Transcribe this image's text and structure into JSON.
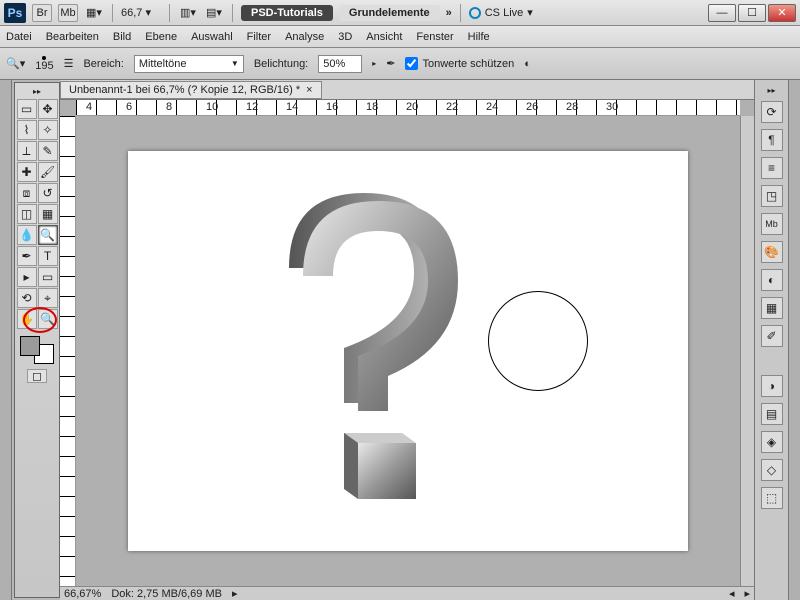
{
  "titlebar": {
    "zoom": "66,7",
    "pill1": "PSD-Tutorials",
    "pill2": "Grundelemente",
    "cslive": "CS Live",
    "br": "Br",
    "mb": "Mb"
  },
  "menu": [
    "Datei",
    "Bearbeiten",
    "Bild",
    "Ebene",
    "Auswahl",
    "Filter",
    "Analyse",
    "3D",
    "Ansicht",
    "Fenster",
    "Hilfe"
  ],
  "options": {
    "brush_size": "195",
    "range_label": "Bereich:",
    "range_value": "Mitteltöne",
    "exposure_label": "Belichtung:",
    "exposure_value": "50%",
    "protect": "Tonwerte schützen"
  },
  "doc": {
    "tab": "Unbenannt-1 bei 66,7% (? Kopie 12, RGB/16) *",
    "ruler": [
      "4",
      "6",
      "8",
      "10",
      "12",
      "14",
      "16",
      "18",
      "20",
      "22",
      "24",
      "26",
      "28",
      "30"
    ]
  },
  "status": {
    "zoom": "66,67%",
    "dok": "Dok: 2,75 MB/6,69 MB"
  },
  "tools": {
    "left": [
      [
        "move",
        "marquee"
      ],
      [
        "lasso",
        "wand"
      ],
      [
        "crop",
        "eyedrop"
      ],
      [
        "heal",
        "brush"
      ],
      [
        "stamp",
        "history"
      ],
      [
        "eraser",
        "gradient"
      ],
      [
        "blur",
        "dodge"
      ],
      [
        "pen",
        "type"
      ],
      [
        "path",
        "shape"
      ],
      [
        "3d",
        "3dcam"
      ],
      [
        "hand",
        "zoom"
      ]
    ],
    "selected": "dodge"
  },
  "right_icons": [
    "history",
    "char",
    "swatch",
    "nav",
    "mb",
    "color",
    "adjust",
    "layers",
    "",
    "mask",
    "fx",
    "3d",
    "styles",
    "info"
  ]
}
